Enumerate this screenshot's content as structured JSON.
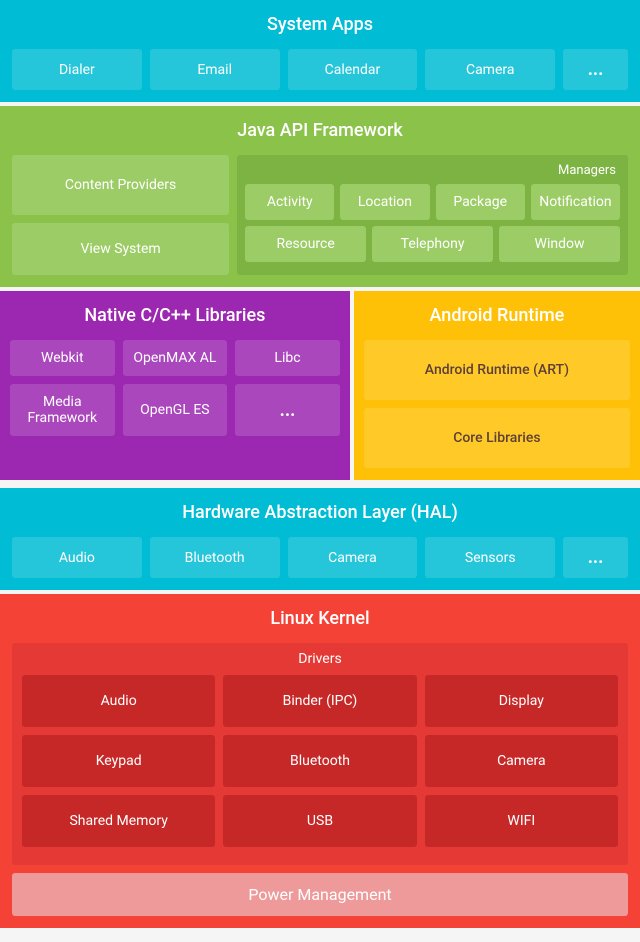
{
  "systemApps": {
    "title": "System Apps",
    "cells": [
      "Dialer",
      "Email",
      "Calendar",
      "Camera",
      "..."
    ]
  },
  "javaApi": {
    "title": "Java API Framework",
    "managersLabel": "Managers",
    "contentProviders": "Content Providers",
    "viewSystem": "View System",
    "managersRow1": [
      "Activity",
      "Location",
      "Package",
      "Notification"
    ],
    "managersRow2": [
      "Resource",
      "Telephony",
      "Window"
    ]
  },
  "nativeLibs": {
    "title": "Native C/C++ Libraries",
    "row1": [
      "Webkit",
      "OpenMAX AL",
      "Libc"
    ],
    "row2": [
      "Media Framework",
      "OpenGL ES",
      "..."
    ]
  },
  "androidRuntime": {
    "title": "Android Runtime",
    "cells": [
      "Android Runtime (ART)",
      "Core Libraries"
    ]
  },
  "hal": {
    "title": "Hardware Abstraction Layer (HAL)",
    "cells": [
      "Audio",
      "Bluetooth",
      "Camera",
      "Sensors",
      "..."
    ]
  },
  "linuxKernel": {
    "title": "Linux Kernel",
    "driversLabel": "Drivers",
    "driversRow1": [
      "Audio",
      "Binder (IPC)",
      "Display"
    ],
    "driversRow2": [
      "Keypad",
      "Bluetooth",
      "Camera"
    ],
    "driversRow3": [
      "Shared Memory",
      "USB",
      "WIFI"
    ],
    "powerManagement": "Power Management"
  }
}
